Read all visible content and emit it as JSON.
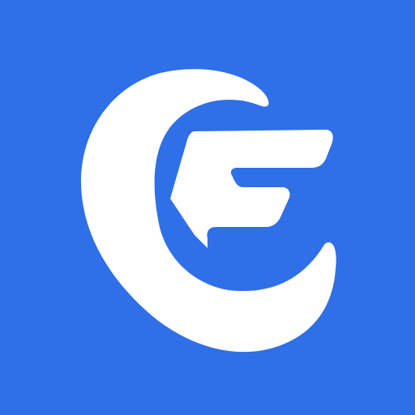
{
  "icon": {
    "name": "cf-logo-icon",
    "background_color": "#2F6FE8",
    "foreground_color": "#FFFFFF"
  }
}
